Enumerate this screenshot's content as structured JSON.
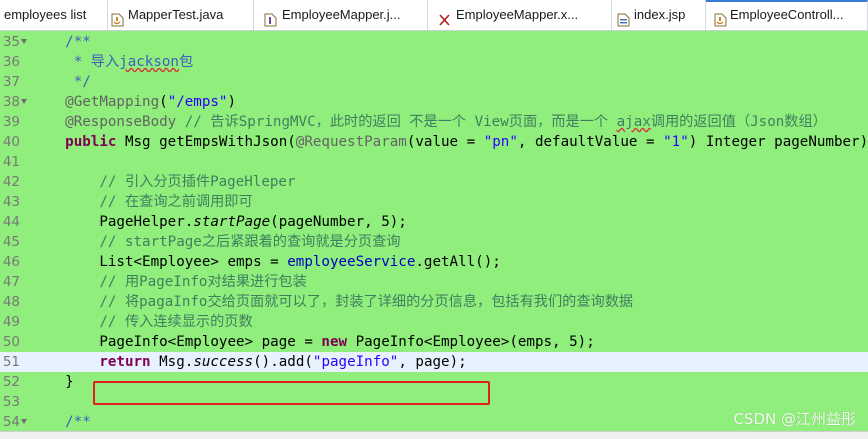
{
  "tabs": [
    {
      "label": "employees list",
      "icon": "none",
      "active": false
    },
    {
      "label": "MapperTest.java",
      "icon": "java-file-icon",
      "active": false
    },
    {
      "label": "EmployeeMapper.j...",
      "icon": "java-interface-icon",
      "active": false
    },
    {
      "label": "EmployeeMapper.x...",
      "icon": "xml-file-icon",
      "active": false
    },
    {
      "label": "index.jsp",
      "icon": "jsp-file-icon",
      "active": false
    },
    {
      "label": "EmployeeControll...",
      "icon": "java-file-icon",
      "active": true
    }
  ],
  "editor": {
    "lines": [
      {
        "num": "35",
        "text": "    /**"
      },
      {
        "num": "36",
        "text": "     * 导入jackson包"
      },
      {
        "num": "37",
        "text": "     */"
      },
      {
        "num": "38",
        "text": "    @GetMapping(\"/emps\")"
      },
      {
        "num": "39",
        "text": "    @ResponseBody // 告诉SpringMVC，此时的返回 不是一个 View页面，而是一个 ajax调用的返回值（Json数组）"
      },
      {
        "num": "40",
        "text": "    public Msg getEmpsWithJson(@RequestParam(value = \"pn\", defaultValue = \"1\") Integer pageNumber) {"
      },
      {
        "num": "41",
        "text": ""
      },
      {
        "num": "42",
        "text": "        // 引入分页插件PageHleper"
      },
      {
        "num": "43",
        "text": "        // 在查询之前调用即可"
      },
      {
        "num": "44",
        "text": "        PageHelper.startPage(pageNumber, 5);"
      },
      {
        "num": "45",
        "text": "        // startPage之后紧跟着的查询就是分页查询"
      },
      {
        "num": "46",
        "text": "        List<Employee> emps = employeeService.getAll();"
      },
      {
        "num": "47",
        "text": "        // 用PageInfo对结果进行包装"
      },
      {
        "num": "48",
        "text": "        // 将pagaInfo交给页面就可以了，封装了详细的分页信息，包括有我们的查询数据"
      },
      {
        "num": "49",
        "text": "        // 传入连续显示的页数"
      },
      {
        "num": "50",
        "text": "        PageInfo<Employee> page = new PageInfo<Employee>(emps, 5);"
      },
      {
        "num": "51",
        "text": "        return Msg.success().add(\"pageInfo\", page);"
      },
      {
        "num": "52",
        "text": "    }"
      },
      {
        "num": "53",
        "text": ""
      },
      {
        "num": "54",
        "text": "    /**"
      }
    ],
    "current_line": "51",
    "highlight_line": "51"
  },
  "colors": {
    "background": "#90ee7c",
    "keyword": "#7f0055",
    "comment": "#3f7f5f",
    "javadoc": "#3f5fbf",
    "string": "#2a00ff",
    "annotation": "#646464",
    "field": "#0000c0",
    "highlight_box": "#e0201f"
  },
  "watermark": "CSDN @江州益彤"
}
